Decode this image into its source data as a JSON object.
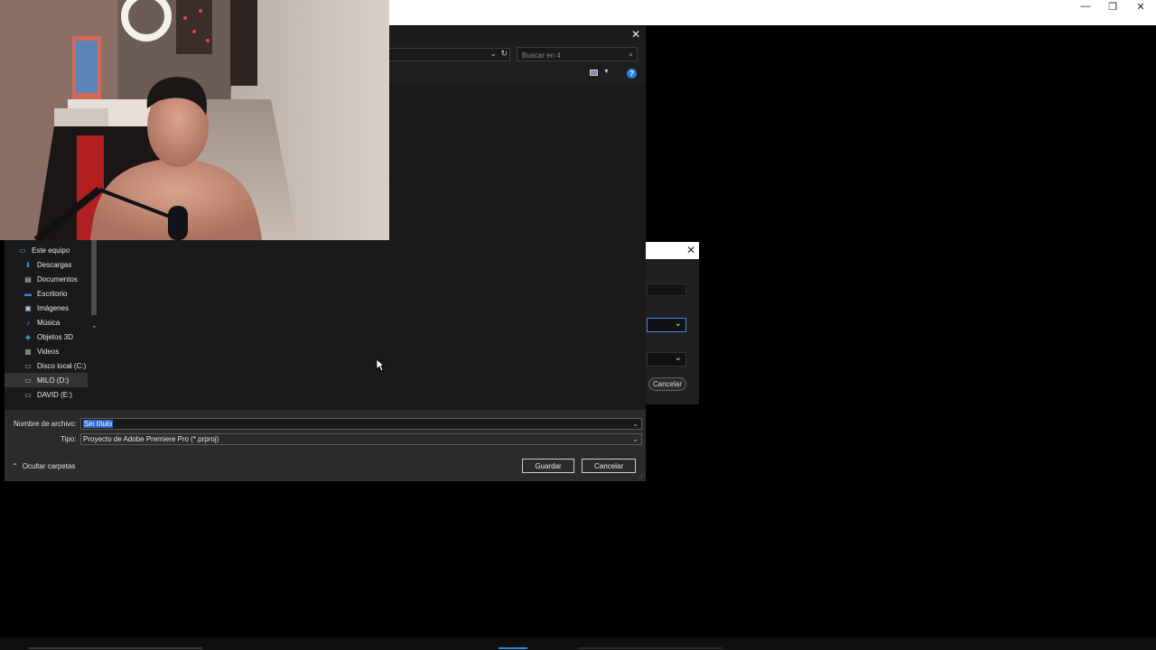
{
  "window_controls": {
    "minimize": "—",
    "restore": "❐",
    "close": "✕"
  },
  "save_dialog": {
    "close": "✕",
    "search": {
      "placeholder": "Buscar en 4",
      "icon": "search-icon"
    },
    "nav_items": [
      {
        "label": "Este equipo",
        "icon": "computer-icon",
        "color": "#5aa0e6"
      },
      {
        "label": "Descargas",
        "icon": "download-icon",
        "color": "#3d8ee0"
      },
      {
        "label": "Documentos",
        "icon": "document-icon",
        "color": "#c9d2dc"
      },
      {
        "label": "Escritorio",
        "icon": "desktop-icon",
        "color": "#2f8be0"
      },
      {
        "label": "Imágenes",
        "icon": "pictures-icon",
        "color": "#b6c7db"
      },
      {
        "label": "Música",
        "icon": "music-icon",
        "color": "#4a9be8"
      },
      {
        "label": "Objetos 3D",
        "icon": "3d-objects-icon",
        "color": "#46b3e6"
      },
      {
        "label": "Videos",
        "icon": "video-icon",
        "color": "#9aa7b5"
      },
      {
        "label": "Disco local (C:)",
        "icon": "drive-icon",
        "color": "#b9c3cd"
      },
      {
        "label": "MILO (D:)",
        "icon": "drive-icon",
        "color": "#b9c3cd"
      },
      {
        "label": "DAVID (E:)",
        "icon": "drive-icon",
        "color": "#b9c3cd"
      }
    ],
    "filename_label": "Nombre de archivo:",
    "filename_value": "Sin título",
    "type_label": "Tipo:",
    "type_value": "Proyecto de Adobe Premiere Pro (*.prproj)",
    "hide_folders": "Ocultar carpetas",
    "save_button": "Guardar",
    "cancel_button": "Cancelar"
  },
  "background_dialog": {
    "cancel_button": "Cancelar",
    "close": "✕"
  }
}
